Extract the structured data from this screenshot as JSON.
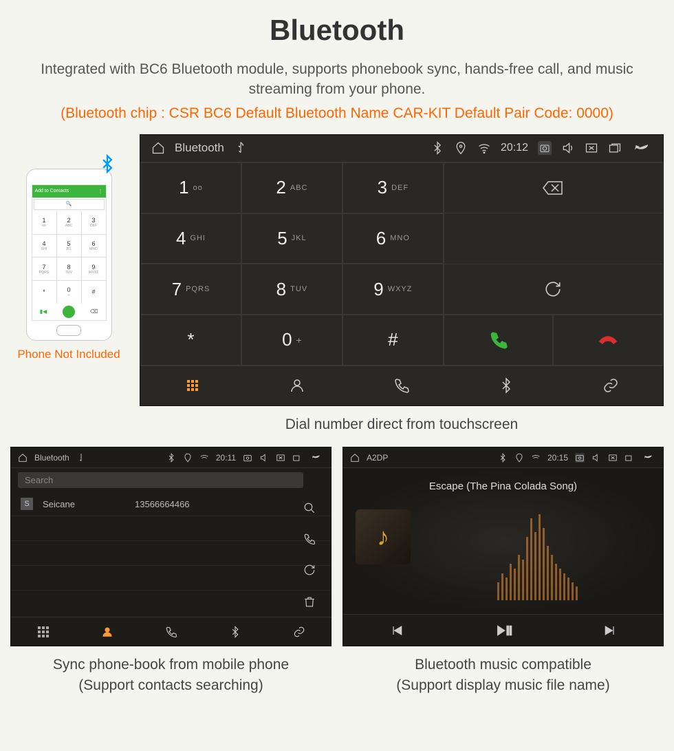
{
  "header": {
    "title": "Bluetooth",
    "description": "Integrated with BC6 Bluetooth module, supports phonebook sync, hands-free call, and music streaming from your phone.",
    "specs": "(Bluetooth chip : CSR BC6     Default Bluetooth Name CAR-KIT     Default Pair Code: 0000)"
  },
  "phone": {
    "top_label": "Add to Contacts",
    "caption": "Phone Not Included",
    "keys": [
      "1",
      "2",
      "3",
      "4",
      "5",
      "6",
      "7",
      "8",
      "9",
      "*",
      "0",
      "#"
    ]
  },
  "main": {
    "status": {
      "title": "Bluetooth",
      "time": "20:12"
    },
    "keys": [
      {
        "num": "1",
        "sub": "ᴏᴏ"
      },
      {
        "num": "2",
        "sub": "ABC"
      },
      {
        "num": "3",
        "sub": "DEF"
      },
      {
        "num": "4",
        "sub": "GHI"
      },
      {
        "num": "5",
        "sub": "JKL"
      },
      {
        "num": "6",
        "sub": "MNO"
      },
      {
        "num": "7",
        "sub": "PQRS"
      },
      {
        "num": "8",
        "sub": "TUV"
      },
      {
        "num": "9",
        "sub": "WXYZ"
      },
      {
        "num": "*",
        "sub": ""
      },
      {
        "num": "0",
        "sub": "+"
      },
      {
        "num": "#",
        "sub": ""
      }
    ],
    "caption": "Dial number direct from touchscreen"
  },
  "contacts": {
    "status": {
      "title": "Bluetooth",
      "time": "20:11"
    },
    "search_placeholder": "Search",
    "item": {
      "initial": "S",
      "name": "Seicane",
      "number": "13566664466"
    },
    "caption_l1": "Sync phone-book from mobile phone",
    "caption_l2": "(Support contacts searching)"
  },
  "music": {
    "status": {
      "title": "A2DP",
      "time": "20:15"
    },
    "song": "Escape (The Pina Colada Song)",
    "caption_l1": "Bluetooth music compatible",
    "caption_l2": "(Support display music file name)"
  }
}
